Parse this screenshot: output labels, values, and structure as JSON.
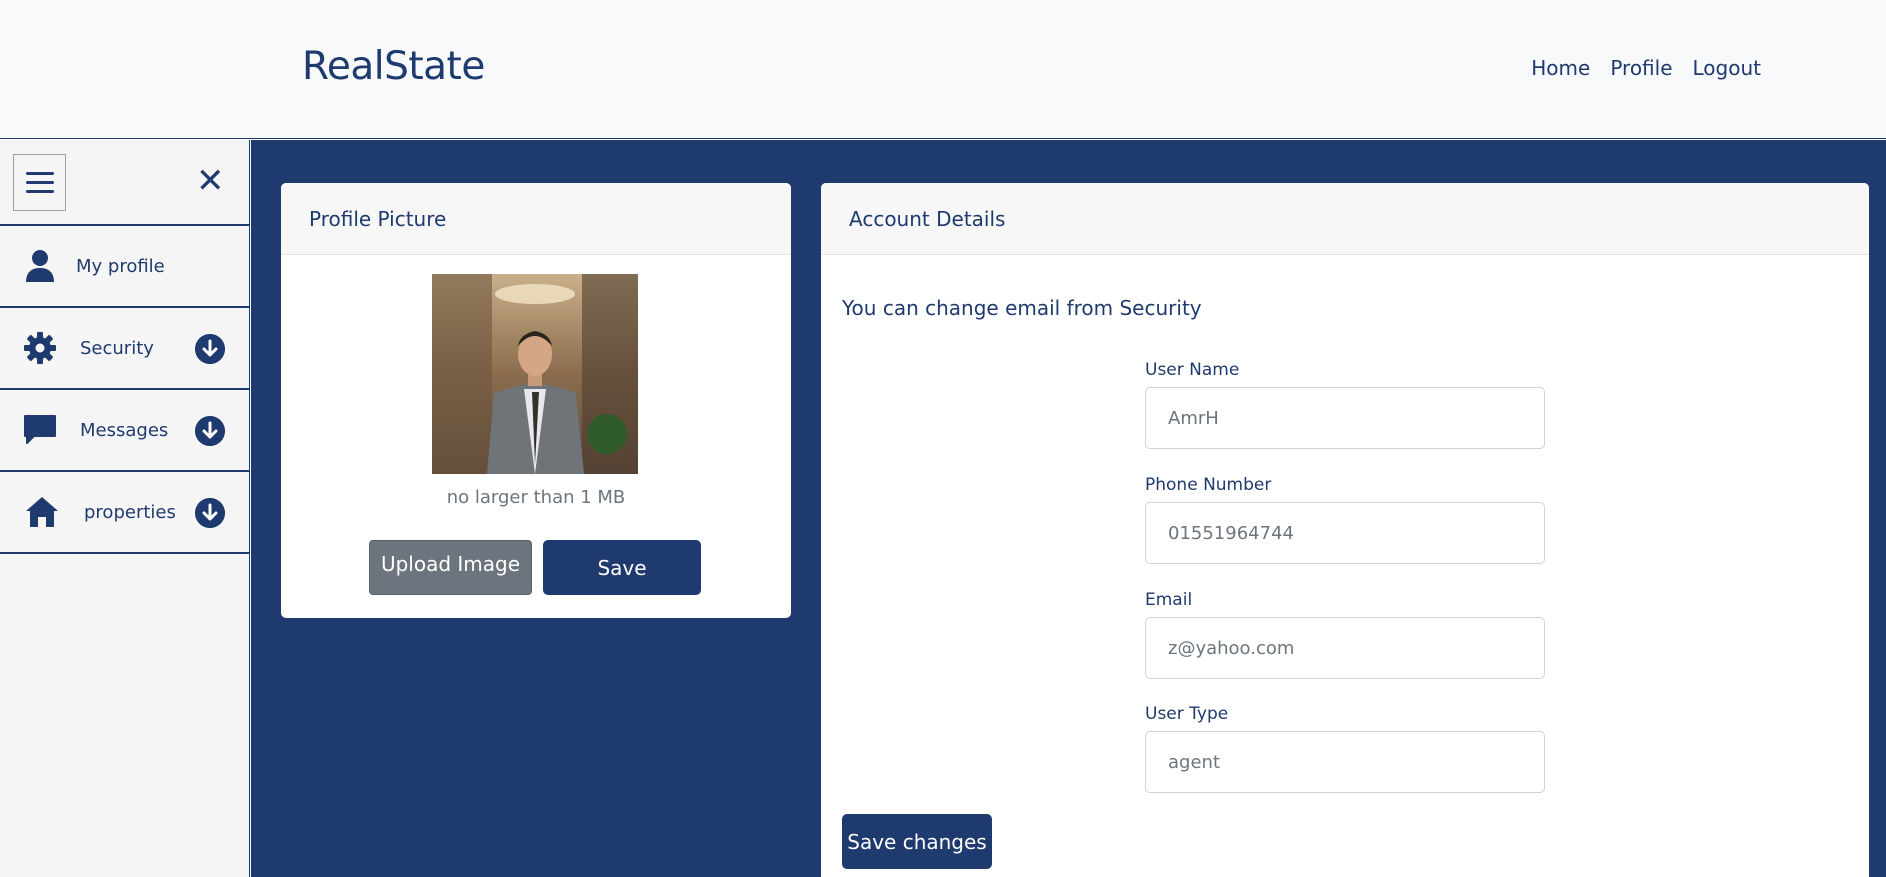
{
  "header": {
    "brand": "RealState",
    "nav": [
      "Home",
      "Profile",
      "Logout"
    ]
  },
  "sidebar": {
    "toggle_icon": "hamburger-icon",
    "close_icon": "close-icon",
    "items": [
      {
        "label": "My profile",
        "icon": "user-icon",
        "expandable": false
      },
      {
        "label": "Security",
        "icon": "gear-icon",
        "expandable": true
      },
      {
        "label": "Messages",
        "icon": "message-icon",
        "expandable": true
      },
      {
        "label": "properties",
        "icon": "home-icon",
        "expandable": true
      }
    ]
  },
  "profile_picture": {
    "title": "Profile Picture",
    "hint": "no larger than 1 MB",
    "upload_label": "Upload Image",
    "save_label": "Save"
  },
  "account_details": {
    "title": "Account Details",
    "note": "You can change email from Security",
    "fields": [
      {
        "label": "User Name",
        "placeholder": "AmrH"
      },
      {
        "label": "Phone Number",
        "placeholder": "01551964744"
      },
      {
        "label": "Email",
        "placeholder": "z@yahoo.com"
      },
      {
        "label": "User Type",
        "placeholder": "agent"
      }
    ],
    "save_label": "Save changes"
  },
  "colors": {
    "primary": "#1f3a6e",
    "secondary_button": "#6c757d",
    "header_bg": "#f8f9fa"
  }
}
